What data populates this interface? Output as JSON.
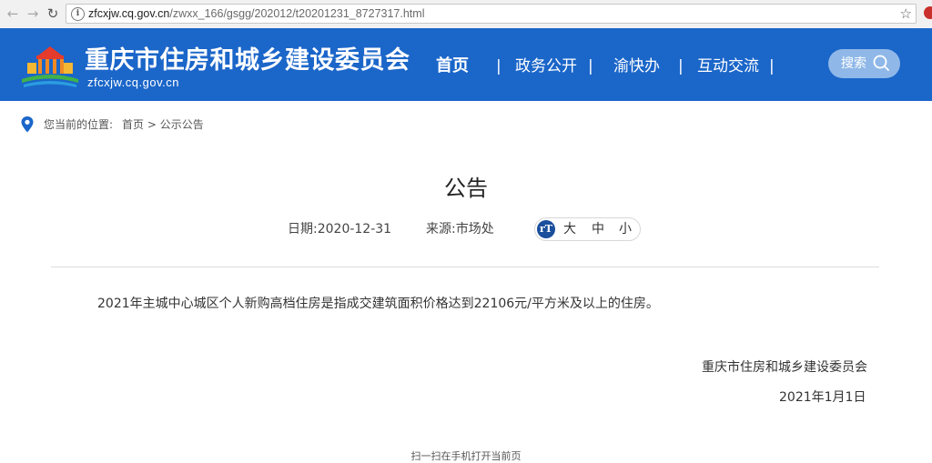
{
  "browser": {
    "url_host": "zfcxjw.cq.gov.cn",
    "url_path": "/zwxx_166/gsgg/202012/t20201231_8727317.html",
    "back_icon": "arrow-left-icon",
    "forward_icon": "arrow-right-icon",
    "reload_icon": "reload-icon",
    "bookmark_icon": "star-icon"
  },
  "header": {
    "site_title": "重庆市住房和城乡建设委员会",
    "site_domain": "zfcxjw.cq.gov.cn",
    "nav": [
      {
        "label": "首页"
      },
      {
        "label": "政务公开"
      },
      {
        "label": "渝快办"
      },
      {
        "label": "互动交流"
      }
    ],
    "separator": "|",
    "search_label": "搜索",
    "colors": {
      "header_bg": "#1b66c9",
      "search_bg": "#8fb8e8"
    }
  },
  "breadcrumb": {
    "prefix": "您当前的位置:",
    "home": "首页",
    "arrow": ">",
    "current": "公示公告"
  },
  "article": {
    "title": "公告",
    "date_label": "日期:2020-12-31",
    "source_label": "来源:市场处",
    "font_sizes": [
      "大",
      "中",
      "小"
    ],
    "body": "2021年主城中心城区个人新购高档住房是指成交建筑面积价格达到22106元/平方米及以上的住房。",
    "signature": "重庆市住房和城乡建设委员会",
    "sign_date": "2021年1月1日"
  },
  "footer": {
    "qr_hint": "扫一扫在手机打开当前页"
  }
}
